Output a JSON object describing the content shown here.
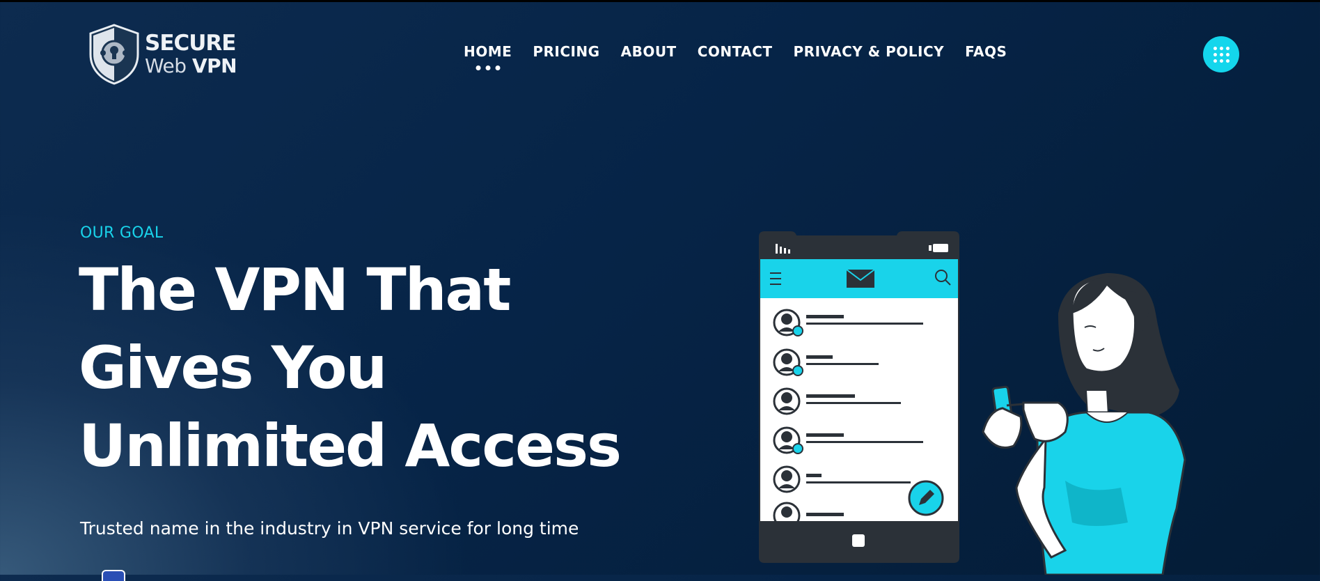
{
  "brand": {
    "line1": "SECURE",
    "line2_light": "Web",
    "line2_bold": "VPN"
  },
  "nav": {
    "items": [
      {
        "label": "HOME",
        "active": true
      },
      {
        "label": "PRICING",
        "active": false
      },
      {
        "label": "ABOUT",
        "active": false
      },
      {
        "label": "CONTACT",
        "active": false
      },
      {
        "label": "PRIVACY & POLICY",
        "active": false
      },
      {
        "label": "FAQS",
        "active": false
      }
    ],
    "menu_icon": "grid-dots-icon"
  },
  "hero": {
    "eyebrow": "OUR GOAL",
    "headline_line1": "The VPN That",
    "headline_line2": "Gives You",
    "headline_line3": "Unlimited Access",
    "subtitle": "Trusted name in the industry in VPN service for long time"
  },
  "colors": {
    "accent": "#14d6ec",
    "background_dark": "#041c36",
    "background_light": "#36597a",
    "text": "#ffffff"
  },
  "illustration": {
    "icons": [
      "signal-bars-icon",
      "battery-icon",
      "hamburger-menu-icon",
      "envelope-icon",
      "search-icon",
      "edit-pencil-icon",
      "home-button-icon"
    ]
  }
}
